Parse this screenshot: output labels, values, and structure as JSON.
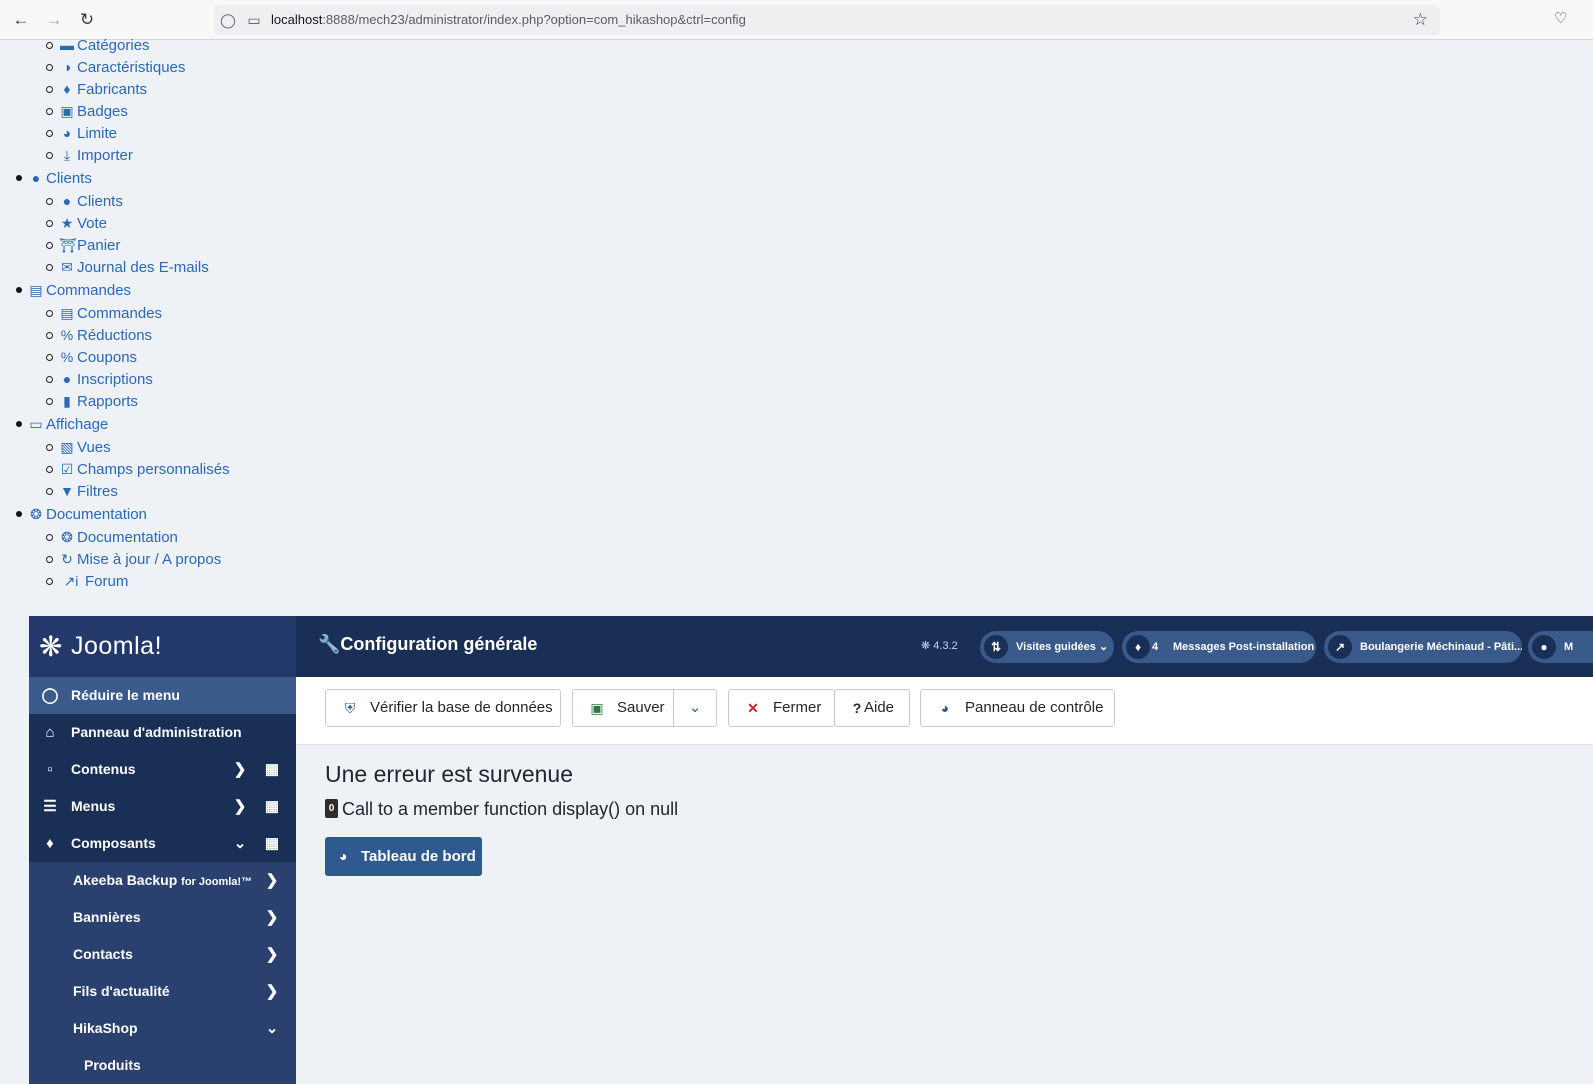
{
  "browser": {
    "url_host": "localhost",
    "url_rest": ":8888/mech23/administrator/index.php?option=com_hikashop&ctrl=config"
  },
  "tree": {
    "catalog_items": [
      "Catégories",
      "Caractéristiques",
      "Fabricants",
      "Badges",
      "Limite",
      "Importer"
    ],
    "clients": {
      "label": "Clients",
      "items": [
        "Clients",
        "Vote",
        "Panier",
        "Journal des E-mails"
      ]
    },
    "orders": {
      "label": "Commandes",
      "items": [
        "Commandes",
        "Réductions",
        "Coupons",
        "Inscriptions",
        "Rapports"
      ]
    },
    "display": {
      "label": "Affichage",
      "items": [
        "Vues",
        "Champs personnalisés",
        "Filtres"
      ]
    },
    "docs": {
      "label": "Documentation",
      "items": [
        "Documentation",
        "Mise à jour / A propos",
        "Forum"
      ]
    }
  },
  "logo": {
    "text": "Joomla!"
  },
  "sidebar": {
    "collapse": "Réduire le menu",
    "admin_panel": "Panneau d'administration",
    "content": "Contenus",
    "menus": "Menus",
    "components": "Composants",
    "sub": {
      "akeeba": "Akeeba Backup",
      "akeeba_suffix": "for Joomla!™",
      "banners": "Bannières",
      "contacts": "Contacts",
      "feeds": "Fils d'actualité",
      "hikashop": "HikaShop",
      "products": "Produits"
    }
  },
  "header": {
    "title": "Configuration générale",
    "version": "4.3.2",
    "tours": "Visites guidées",
    "messages_count": "4",
    "messages": "Messages Post-installation",
    "site": "Boulangerie Méchinaud - Pâti...",
    "user_initial": "M"
  },
  "toolbar": {
    "check_db": "Vérifier la base de données",
    "save": "Sauver",
    "close": "Fermer",
    "help": "Aide",
    "control_panel": "Panneau de contrôle"
  },
  "error": {
    "title": "Une erreur est survenue",
    "code": "0",
    "message": "Call to a member function display() on null",
    "dashboard_button": "Tableau de bord"
  }
}
